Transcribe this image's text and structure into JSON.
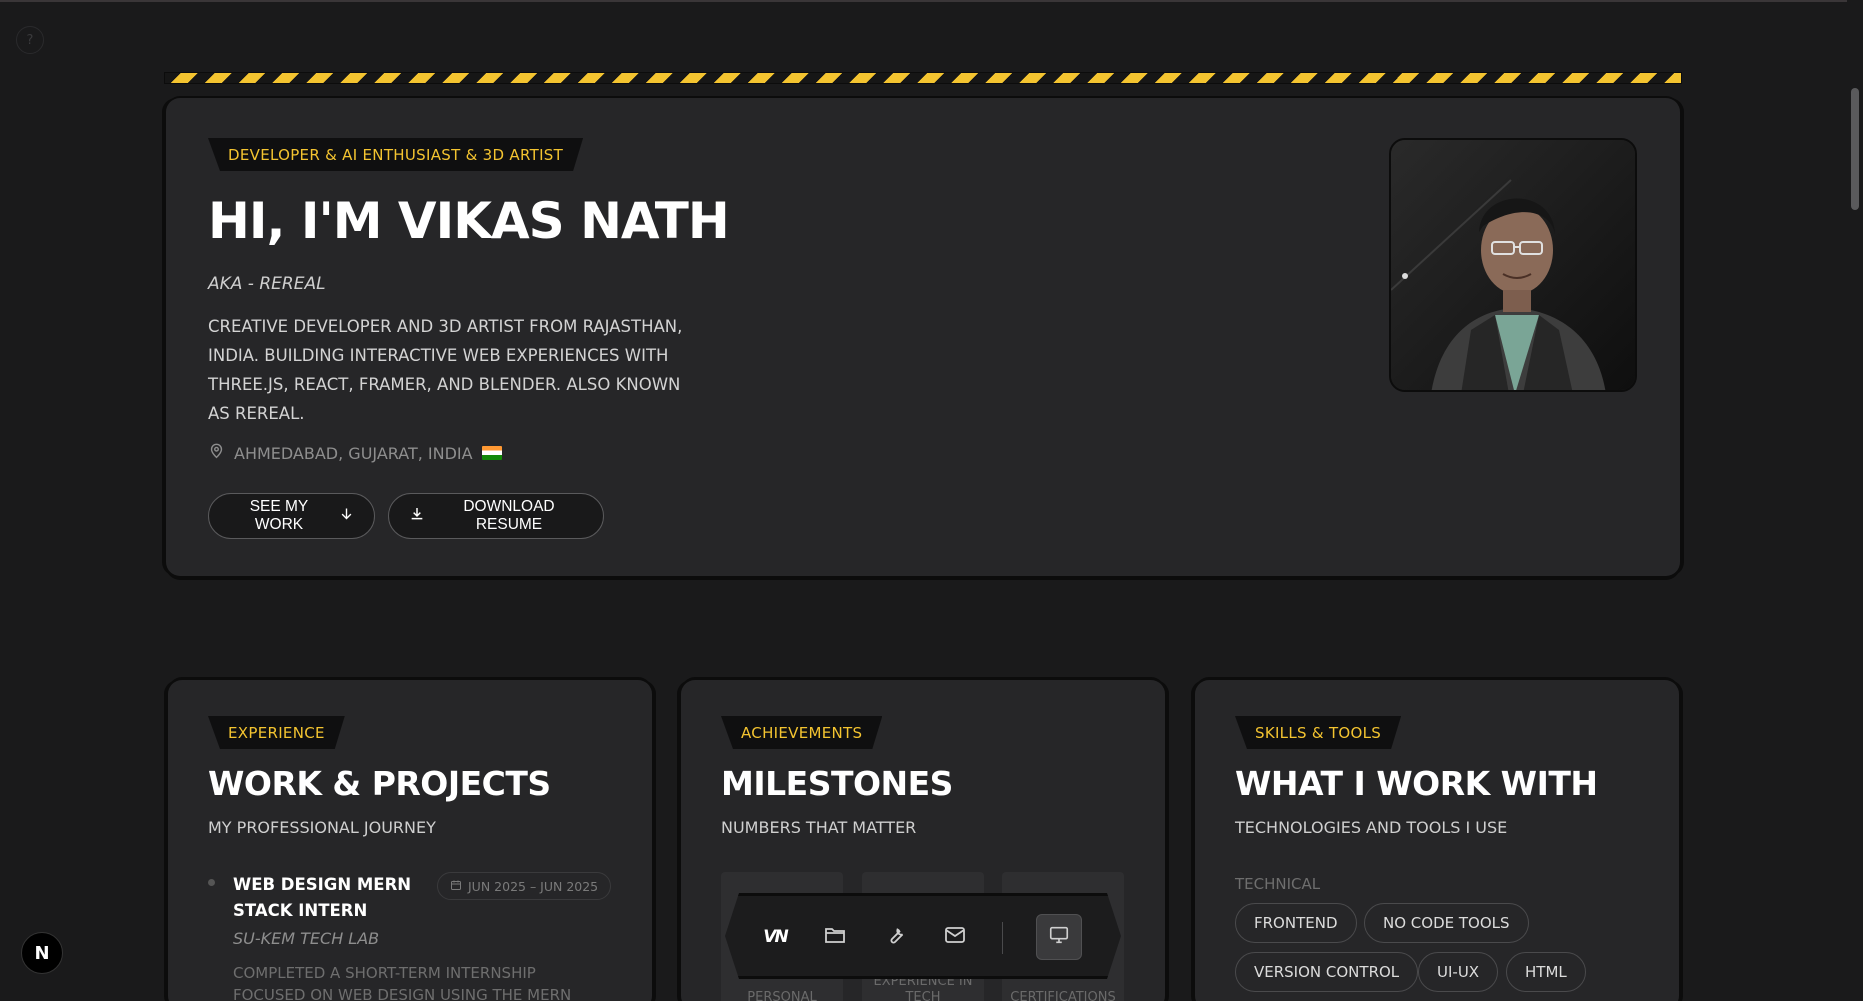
{
  "hero": {
    "tag": "DEVELOPER & AI ENTHUSIAST & 3D ARTIST",
    "title": "HI, I'M VIKAS NATH",
    "aka": "AKA - REREAL",
    "description": "CREATIVE DEVELOPER AND 3D ARTIST FROM RAJASTHAN, INDIA. BUILDING INTERACTIVE WEB EXPERIENCES WITH THREE.JS, REACT, FRAMER, AND BLENDER. ALSO KNOWN AS REREAL.",
    "location": "AHMEDABAD, GUJARAT, INDIA",
    "see_work_label": "SEE MY WORK",
    "resume_label": "DOWNLOAD RESUME"
  },
  "experience": {
    "tag": "EXPERIENCE",
    "title": "WORK & PROJECTS",
    "subtitle": "MY PROFESSIONAL JOURNEY",
    "item": {
      "title": "WEB DESIGN MERN STACK INTERN",
      "date": "JUN 2025 – JUN 2025",
      "company": "SU-KEM TECH LAB",
      "description": "COMPLETED A SHORT-TERM INTERNSHIP FOCUSED ON WEB DESIGN USING THE MERN STACK. WORKED"
    }
  },
  "achievements": {
    "tag": "ACHIEVEMENTS",
    "title": "MILESTONES",
    "subtitle": "NUMBERS THAT MATTER",
    "stats": [
      {
        "label": "PERSONAL"
      },
      {
        "label": "EXPERIENCE IN TECH"
      },
      {
        "label": "CERTIFICATIONS"
      }
    ]
  },
  "skills": {
    "tag": "SKILLS & TOOLS",
    "title": "WHAT I WORK WITH",
    "subtitle": "TECHNOLOGIES AND TOOLS I USE",
    "group_label": "TECHNICAL",
    "pills": [
      "FRONTEND",
      "NO CODE TOOLS",
      "VERSION CONTROL",
      "UI-UX",
      "HTML"
    ]
  },
  "dock": {
    "logo": "VN"
  },
  "framework_badge": "N",
  "help_glyph": "?",
  "colors": {
    "accent": "#f4c430",
    "background": "#1a1a1b",
    "card": "#262628"
  }
}
